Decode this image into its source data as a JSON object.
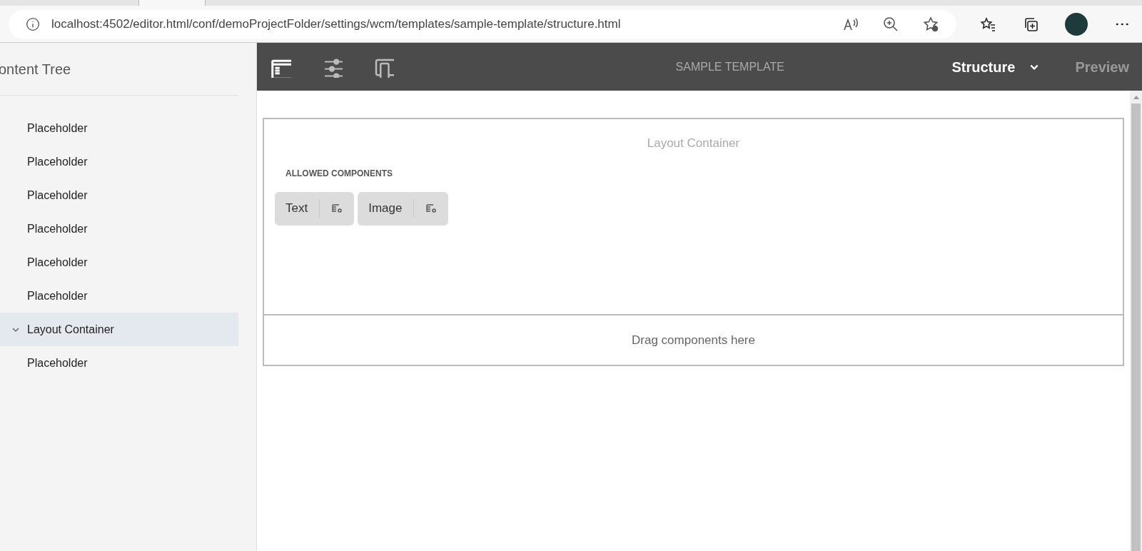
{
  "browser": {
    "url": "localhost:4502/editor.html/conf/demoProjectFolder/settings/wcm/templates/sample-template/structure.html"
  },
  "sidebar": {
    "title": "ontent Tree",
    "items": [
      {
        "label": "Placeholder",
        "selected": false
      },
      {
        "label": "Placeholder",
        "selected": false
      },
      {
        "label": "Placeholder",
        "selected": false
      },
      {
        "label": "Placeholder",
        "selected": false
      },
      {
        "label": "Placeholder",
        "selected": false
      },
      {
        "label": "Placeholder",
        "selected": false
      },
      {
        "label": "Layout Container",
        "selected": true,
        "expanded": true
      },
      {
        "label": "Placeholder",
        "selected": false
      }
    ]
  },
  "toolbar": {
    "title": "SAMPLE TEMPLATE",
    "mode": "Structure",
    "preview": "Preview"
  },
  "canvas": {
    "container_title": "Layout Container",
    "allowed_heading": "ALLOWED COMPONENTS",
    "components": [
      {
        "label": "Text"
      },
      {
        "label": "Image"
      }
    ],
    "drop_zone": "Drag components here"
  }
}
